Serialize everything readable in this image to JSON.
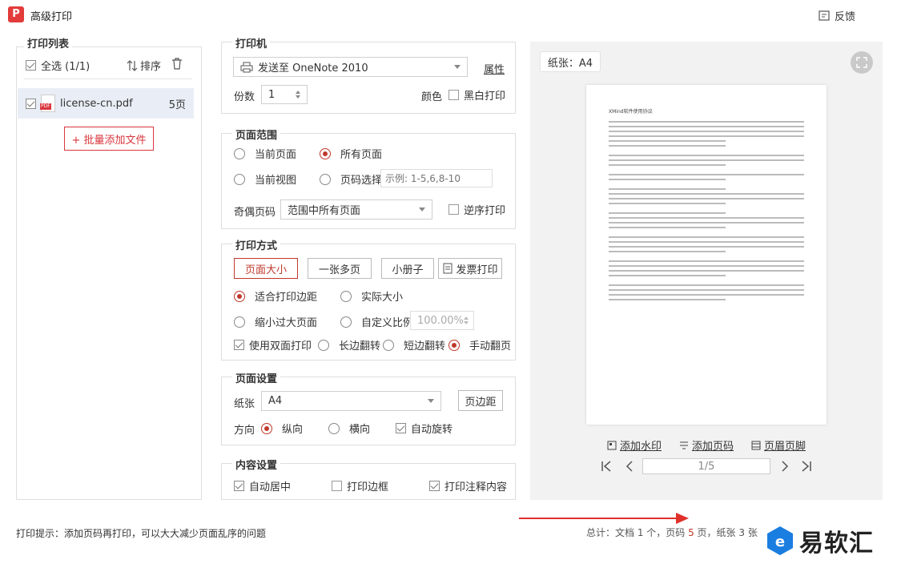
{
  "window": {
    "title": "高级打印",
    "logo_letter": "P",
    "feedback": "反馈"
  },
  "print_list": {
    "title": "打印列表",
    "select_all": "全选 (1/1)",
    "sort": "排序",
    "files": [
      {
        "name": "license-cn.pdf",
        "pages": "5页",
        "badge": "PDF"
      }
    ],
    "add_files": "+ 批量添加文件"
  },
  "printer": {
    "title": "打印机",
    "selected": "发送至 OneNote 2010",
    "properties": "属性",
    "copies_label": "份数",
    "copies_value": "1",
    "color_label": "颜色",
    "bw_label": "黑白打印"
  },
  "page_range": {
    "title": "页面范围",
    "current_page": "当前页面",
    "all_pages": "所有页面",
    "current_view": "当前视图",
    "page_select": "页码选择",
    "page_select_placeholder": "示例: 1-5,6,8-10",
    "odd_even_label": "奇偶页码",
    "odd_even_value": "范围中所有页面",
    "reverse": "逆序打印"
  },
  "print_mode": {
    "title": "打印方式",
    "modes": [
      "页面大小",
      "一张多页",
      "小册子",
      "发票打印"
    ],
    "fit_margin": "适合打印边距",
    "actual_size": "实际大小",
    "shrink": "缩小过大页面",
    "custom_scale": "自定义比例",
    "scale_value": "100.00%",
    "duplex": "使用双面打印",
    "long_edge": "长边翻转",
    "short_edge": "短边翻转",
    "manual": "手动翻页"
  },
  "page_setup": {
    "title": "页面设置",
    "paper_label": "纸张",
    "paper_value": "A4",
    "margins": "页边距",
    "orientation_label": "方向",
    "portrait": "纵向",
    "landscape": "横向",
    "auto_rotate": "自动旋转"
  },
  "content": {
    "title": "内容设置",
    "center": "自动居中",
    "border": "打印边框",
    "annotations": "打印注释内容"
  },
  "preview": {
    "paper": "纸张：A4",
    "watermark": "添加水印",
    "page_number": "添加页码",
    "header_footer": "页眉页脚",
    "page_indicator": "1/5",
    "doc_title": "XMind软件使用协议"
  },
  "footer": {
    "tip": "打印提示：添加页码再打印，可以大大减少页面乱序的问题",
    "summary_prefix": "总计：文档 1 个，页码 ",
    "summary_pages": "5",
    "summary_mid": " 页，纸张 3 张",
    "watermark_brand": "易软汇"
  },
  "colors": {
    "accent": "#c0392b",
    "logo": "#e33b3b",
    "brand": "#1a7de0"
  }
}
